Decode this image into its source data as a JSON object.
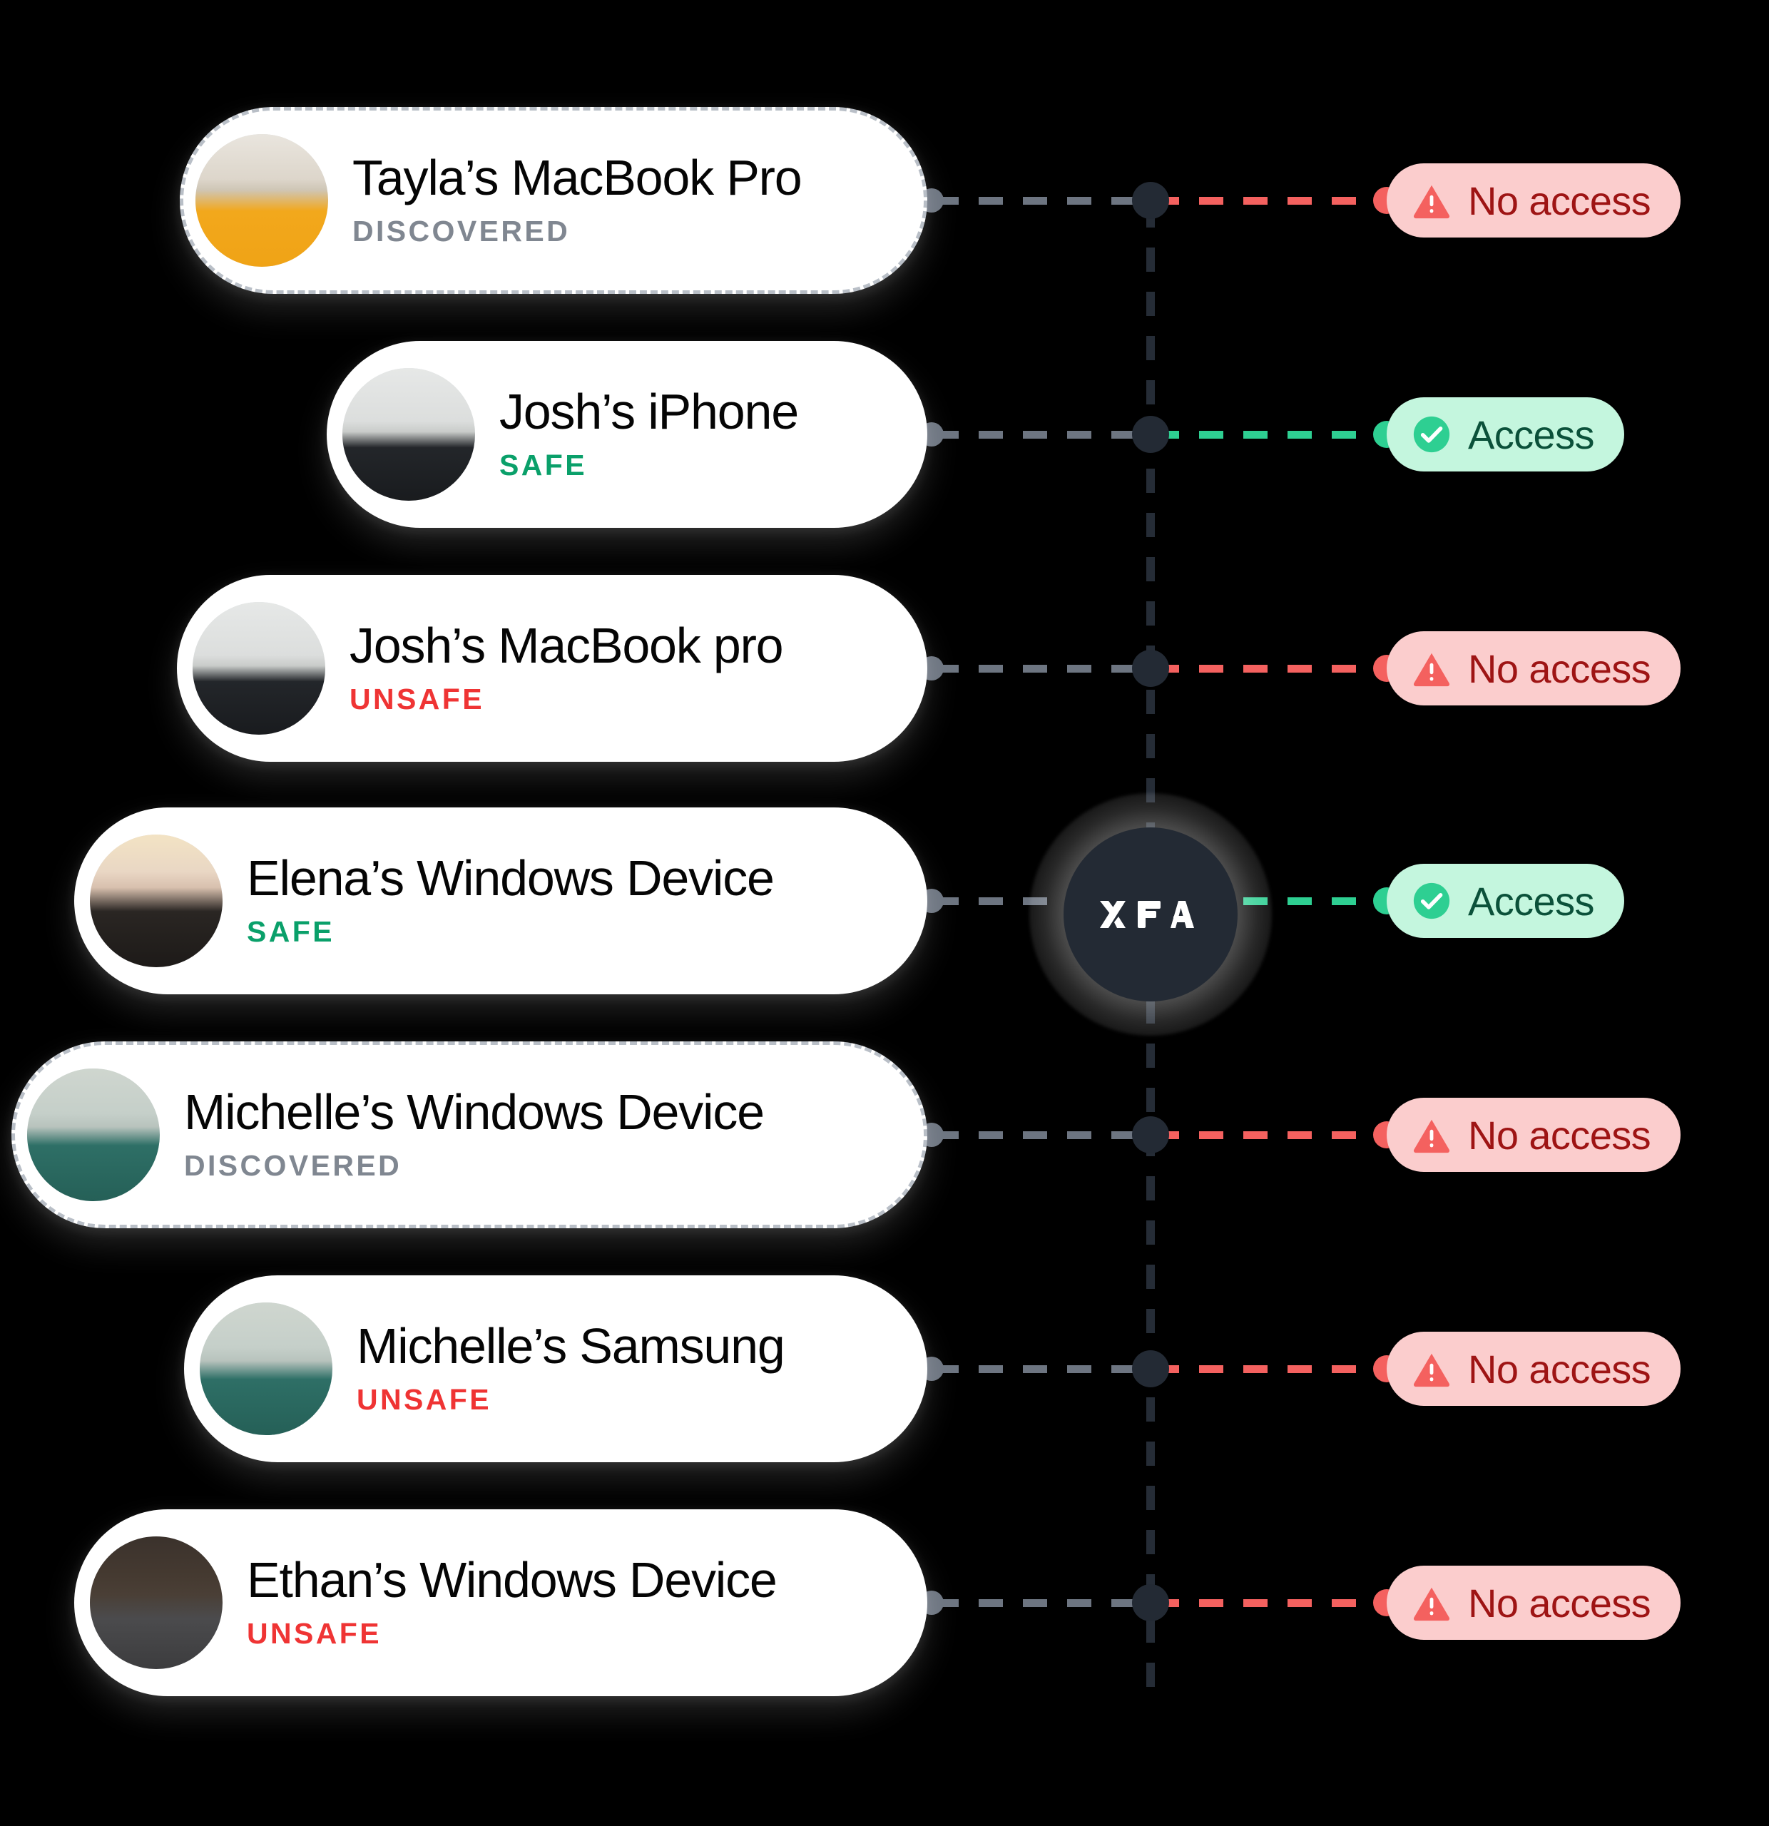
{
  "hub": {
    "name": "XFA",
    "logo_icon": "xfa-logo-icon",
    "core_color": "#232a34"
  },
  "legend_colors": {
    "safe": "#0aa06a",
    "unsafe": "#ef3434",
    "discovered": "#808791",
    "access_bg": "#c4f6de",
    "access_text": "#0b513a",
    "access_icon": "#2ecf92",
    "no_access_bg": "#fbcdcd",
    "no_access_text": "#9e1414",
    "no_access_icon": "#f4615f",
    "connector_gray": "#6d7581",
    "backbone": "#252c36"
  },
  "devices": [
    {
      "name": "Tayla’s MacBook Pro",
      "status": "DISCOVERED",
      "access": "No access",
      "access_state": "deny",
      "access_icon": "warning-triangle-icon",
      "avatar_icon": "avatar-tayla"
    },
    {
      "name": "Josh’s iPhone",
      "status": "SAFE",
      "access": "Access",
      "access_state": "allow",
      "access_icon": "check-circle-icon",
      "avatar_icon": "avatar-josh"
    },
    {
      "name": "Josh’s MacBook pro",
      "status": "UNSAFE",
      "access": "No access",
      "access_state": "deny",
      "access_icon": "warning-triangle-icon",
      "avatar_icon": "avatar-josh"
    },
    {
      "name": "Elena’s Windows Device",
      "status": "SAFE",
      "access": "Access",
      "access_state": "allow",
      "access_icon": "check-circle-icon",
      "avatar_icon": "avatar-elena"
    },
    {
      "name": "Michelle’s Windows Device",
      "status": "DISCOVERED",
      "access": "No access",
      "access_state": "deny",
      "access_icon": "warning-triangle-icon",
      "avatar_icon": "avatar-michelle"
    },
    {
      "name": "Michelle’s Samsung",
      "status": "UNSAFE",
      "access": "No access",
      "access_state": "deny",
      "access_icon": "warning-triangle-icon",
      "avatar_icon": "avatar-michelle"
    },
    {
      "name": "Ethan’s Windows Device",
      "status": "UNSAFE",
      "access": "No access",
      "access_state": "deny",
      "access_icon": "warning-triangle-icon",
      "avatar_icon": "avatar-ethan"
    }
  ]
}
